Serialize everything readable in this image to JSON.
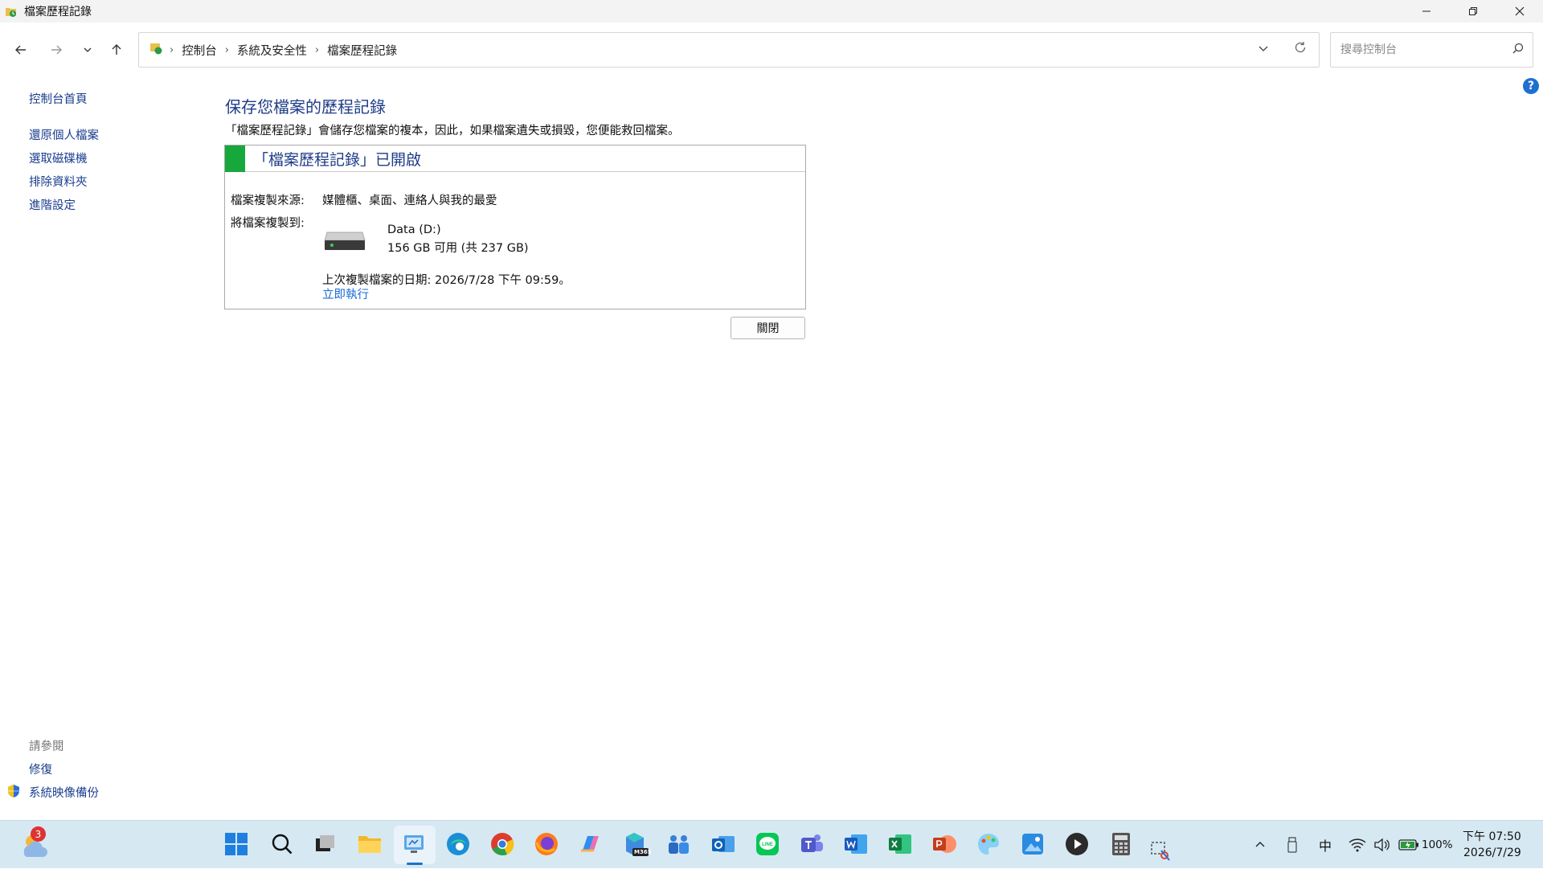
{
  "window": {
    "title": "檔案歷程記錄",
    "minimize": "—",
    "maximize": "❐",
    "close": "✕"
  },
  "nav": {
    "breadcrumb": [
      "控制台",
      "系統及安全性",
      "檔案歷程記錄"
    ],
    "search_placeholder": "搜尋控制台"
  },
  "sidebar": {
    "items": [
      "控制台首頁",
      "還原個人檔案",
      "選取磁碟機",
      "排除資料夾",
      "進階設定"
    ],
    "see_also_header": "請參閱",
    "see_also": [
      "修復",
      "系統映像備份"
    ]
  },
  "main": {
    "heading": "保存您檔案的歷程記錄",
    "description": "「檔案歷程記錄」會儲存您檔案的複本，因此，如果檔案遺失或損毀，您便能救回檔案。",
    "status": "「檔案歷程記錄」已開啟",
    "source_label": "檔案複製來源:",
    "source_value": "媒體櫃、桌面、連絡人與我的最愛",
    "target_label": "將檔案複製到:",
    "drive_name": "Data (D:)",
    "drive_space": "156 GB 可用 (共 237 GB)",
    "last_copy": "上次複製檔案的日期: 2026/7/28 下午 09:59。",
    "run_now": "立即執行",
    "close_button": "關閉"
  },
  "taskbar": {
    "weather_badge": "3",
    "apps": [
      "start-icon",
      "search-icon",
      "task-view-icon",
      "file-explorer-icon",
      "control-panel-icon",
      "edge-icon",
      "chrome-icon",
      "firefox-icon",
      "copilot-icon",
      "m365-icon",
      "people-icon",
      "outlook-icon",
      "line-icon",
      "teams-icon",
      "word-icon",
      "excel-icon",
      "powerpoint-icon",
      "paint-icon",
      "photos-icon",
      "media-player-icon",
      "calculator-icon",
      "snipping-icon"
    ],
    "m365_label": "M365",
    "tray": {
      "ime": "中",
      "battery": "100%"
    },
    "clock": {
      "time": "下午 07:50",
      "date": "2026/7/29"
    }
  },
  "colors": {
    "accent": "#1f3c88",
    "status_green": "#17a83b",
    "link": "#1a6bd6",
    "taskbar": "#d6e9f2"
  }
}
